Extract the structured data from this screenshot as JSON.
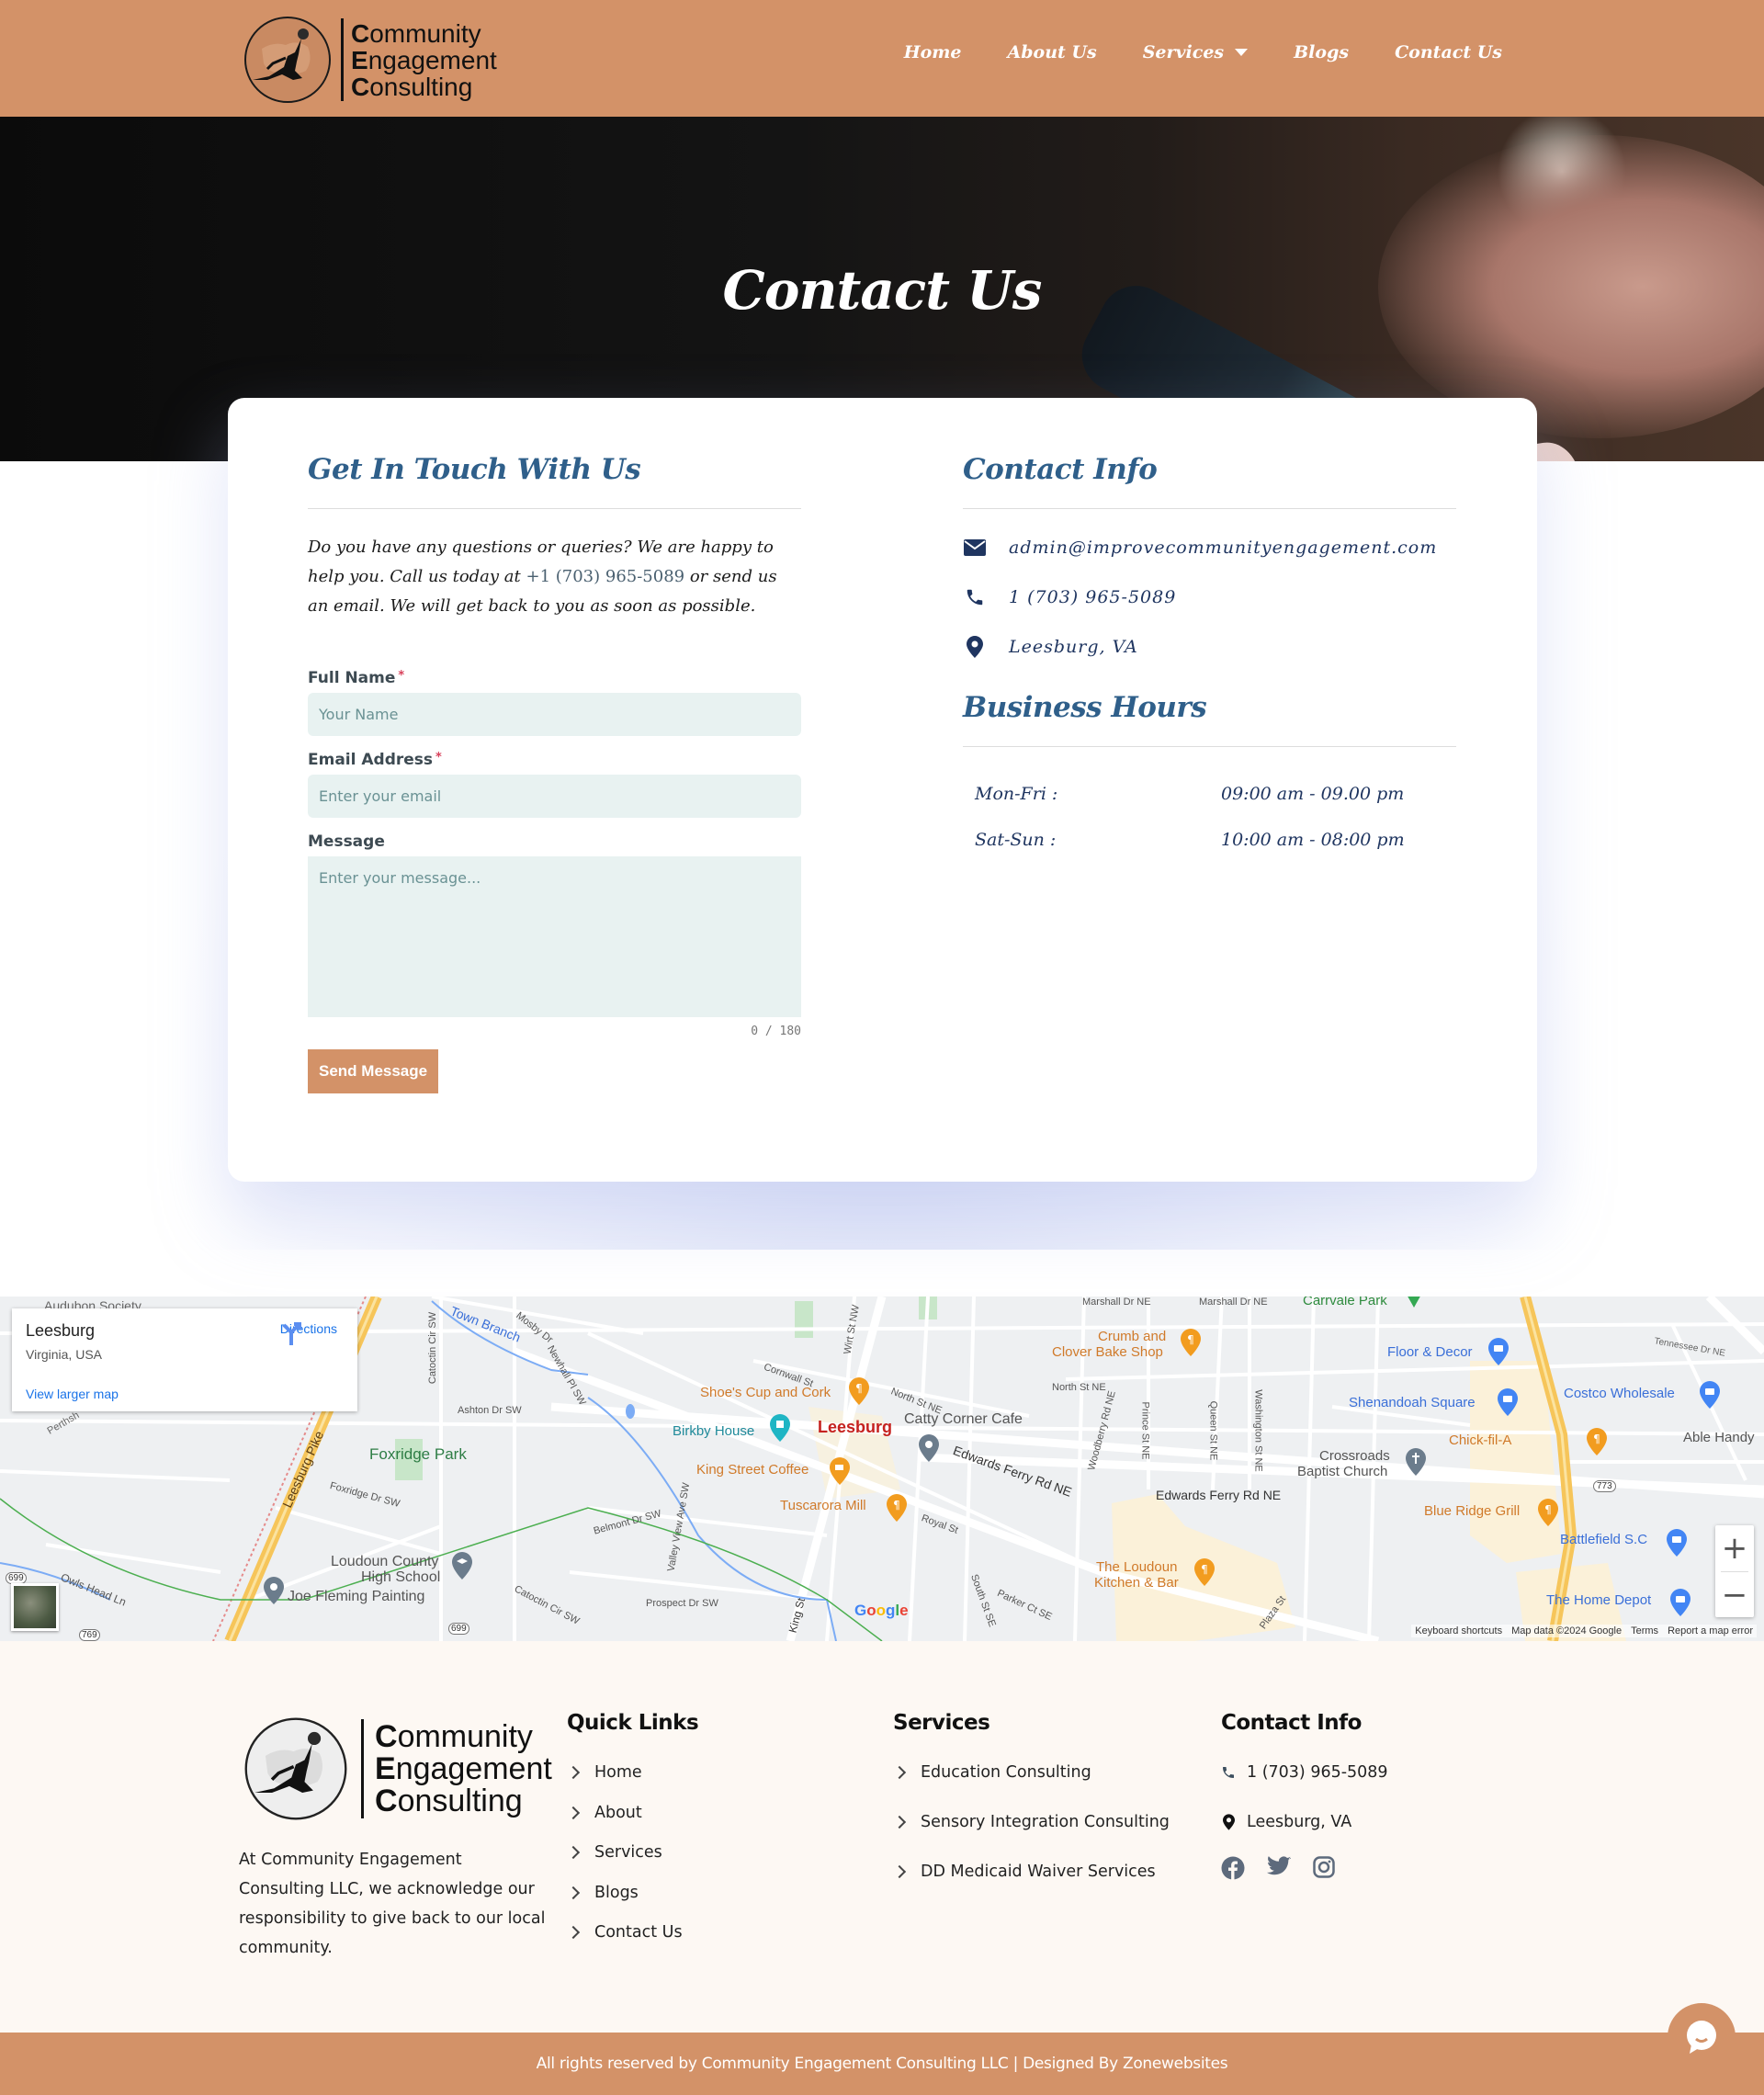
{
  "brand": {
    "name_lines": [
      "Community",
      "Engagement",
      "Consulting"
    ],
    "accent_color": "#d39268",
    "heading_color": "#2f5f8a",
    "text_navy": "#1f3560"
  },
  "nav": {
    "items": [
      {
        "label": "Home"
      },
      {
        "label": "About Us"
      },
      {
        "label": "Services",
        "has_dropdown": true
      },
      {
        "label": "Blogs"
      },
      {
        "label": "Contact Us"
      }
    ]
  },
  "hero": {
    "title": "Contact Us"
  },
  "form_section": {
    "title": "Get In Touch With Us",
    "intro_before": "Do you have any questions or queries? We are happy to help you. Call us today at ",
    "intro_phone": "+1 (703) 965-5089",
    "intro_after": " or send us an email. We will get back to you as soon as possible.",
    "fields": {
      "name": {
        "label": "Full Name",
        "required": "*",
        "placeholder": "Your Name",
        "value": ""
      },
      "email": {
        "label": "Email Address",
        "required": "*",
        "placeholder": "Enter your email",
        "value": ""
      },
      "message": {
        "label": "Message",
        "placeholder": "Enter your message...",
        "value": ""
      }
    },
    "char_counter": "0 / 180",
    "submit_label": "Send Message"
  },
  "contact_info": {
    "title": "Contact Info",
    "items": [
      {
        "icon": "envelope-icon",
        "text": "admin@improvecommunityengagement.com"
      },
      {
        "icon": "phone-icon",
        "text": "1 (703) 965-5089"
      },
      {
        "icon": "map-pin-icon",
        "text": "Leesburg, VA"
      }
    ]
  },
  "business_hours": {
    "title": "Business Hours",
    "rows": [
      {
        "days": "Mon-Fri :",
        "hours": "09:00 am - 09.00 pm"
      },
      {
        "days": "Sat-Sun :",
        "hours": "10:00 am - 08:00 pm"
      }
    ]
  },
  "map": {
    "place_title": "Leesburg",
    "place_subtitle": "Virginia, USA",
    "directions_label": "Directions",
    "view_larger_label": "View larger map",
    "zoom_in": "+",
    "zoom_out": "−",
    "footer_links": [
      "Keyboard shortcuts",
      "Map data ©2024 Google",
      "Terms",
      "Report a map error"
    ],
    "center_label": "Leesburg",
    "labels": {
      "audubon": "Audubon Society",
      "town_branch": "Town Branch",
      "mosby": "Mosby Dr",
      "catoctin": "Catoctin Cir SW",
      "newhall": "Newhall Pl SW",
      "ashton": "Ashton Dr SW",
      "perthshire": "Perthsh",
      "leesburg_pike": "Leesburg Pike",
      "foxridge_park": "Foxridge Park",
      "foxridge_dr": "Foxridge Dr SW",
      "lchs1": "Loudoun County",
      "lchs2": "High School",
      "joe_fleming": "Joe Fleming Painting",
      "owls_head": "Owls Head Ln",
      "catoctin2": "Catoctin Cir SW",
      "r699": "699",
      "r769": "769",
      "cornwall": "Cornwall St",
      "wirt": "Wirt St NW",
      "north_st": "North St NE",
      "shoes": "Shoe's Cup and Cork",
      "birkby": "Birkby House",
      "catty": "Catty Corner Cafe",
      "edwards": "Edwards Ferry Rd NE",
      "king_coffee": "King Street Coffee",
      "tuscarora": "Tuscarora Mill",
      "royal": "Royal St",
      "belmont": "Belmont Dr SW",
      "valley_view": "Valley View Ave SW",
      "prospect": "Prospect Dr SW",
      "king_st": "King St",
      "south_st": "South St SE",
      "parker": "Parker Ct SE",
      "crumb1": "Crumb and",
      "crumb2": "Clover Bake Shop",
      "north_st2": "North St NE",
      "woodberry": "Woodberry Rd NE",
      "prince": "Prince St NE",
      "queen": "Queen St NE",
      "washington": "Washington St NE",
      "edwards2": "Edwards Ferry Rd NE",
      "loudoun_k1": "The Loudoun",
      "loudoun_k2": "Kitchen & Bar",
      "plaza": "Plaza St",
      "marshall": "Marshall Dr NE",
      "marshall2": "Marshall Dr NE",
      "carrvale": "Carrvale Park",
      "floor_decor": "Floor & Decor",
      "shenandoah": "Shenandoah Square",
      "crossroads1": "Crossroads",
      "crossroads2": "Baptist Church",
      "costco": "Costco Wholesale",
      "chickfila": "Chick-fil-A",
      "able": "Able Handy",
      "r773": "773",
      "blue_ridge": "Blue Ridge Grill",
      "battlefield": "Battlefield S.C",
      "home_depot": "The Home Depot",
      "tennessee": "Tennessee Dr NE"
    }
  },
  "footer": {
    "about": "At Community Engagement Consulting LLC, we acknowledge our responsibility to give back to our local community.",
    "quick_links": {
      "title": "Quick Links",
      "items": [
        "Home",
        "About",
        "Services",
        "Blogs",
        "Contact Us"
      ]
    },
    "services": {
      "title": "Services",
      "items": [
        "Education Consulting",
        "Sensory Integration Consulting",
        "DD Medicaid Waiver Services"
      ]
    },
    "contact": {
      "title": "Contact Info",
      "phone": "1 (703) 965-5089",
      "location": "Leesburg, VA",
      "socials": [
        "facebook-icon",
        "twitter-icon",
        "instagram-icon"
      ]
    },
    "copyright": "All rights reserved by Community Engagement Consulting LLC | Designed By Zonewebsites"
  }
}
